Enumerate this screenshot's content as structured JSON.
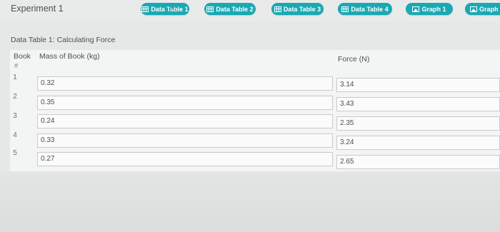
{
  "header": {
    "experiment_title": "Experiment 1",
    "tabs": [
      {
        "label": "Data Table 1",
        "icon": "table-icon"
      },
      {
        "label": "Data Table 2",
        "icon": "table-icon"
      },
      {
        "label": "Data Table 3",
        "icon": "table-icon"
      },
      {
        "label": "Data Table 4",
        "icon": "table-icon"
      },
      {
        "label": "Graph 1",
        "icon": "image-icon"
      },
      {
        "label": "Graph",
        "icon": "image-icon"
      }
    ],
    "tab_color": "#1aa9b3"
  },
  "table": {
    "title": "Data Table 1: Calculating Force",
    "headers": {
      "book_num_line1": "Book",
      "book_num_line2": "#",
      "mass": "Mass of Book (kg)",
      "force": "Force (N)"
    },
    "rows": [
      {
        "num": "1",
        "mass": "0.32",
        "force": "3.14"
      },
      {
        "num": "2",
        "mass": "0.35",
        "force": "3.43"
      },
      {
        "num": "3",
        "mass": "0.24",
        "force": "2.35"
      },
      {
        "num": "4",
        "mass": "0.33",
        "force": "3.24"
      },
      {
        "num": "5",
        "mass": "0.27",
        "force": "2.65"
      }
    ]
  }
}
